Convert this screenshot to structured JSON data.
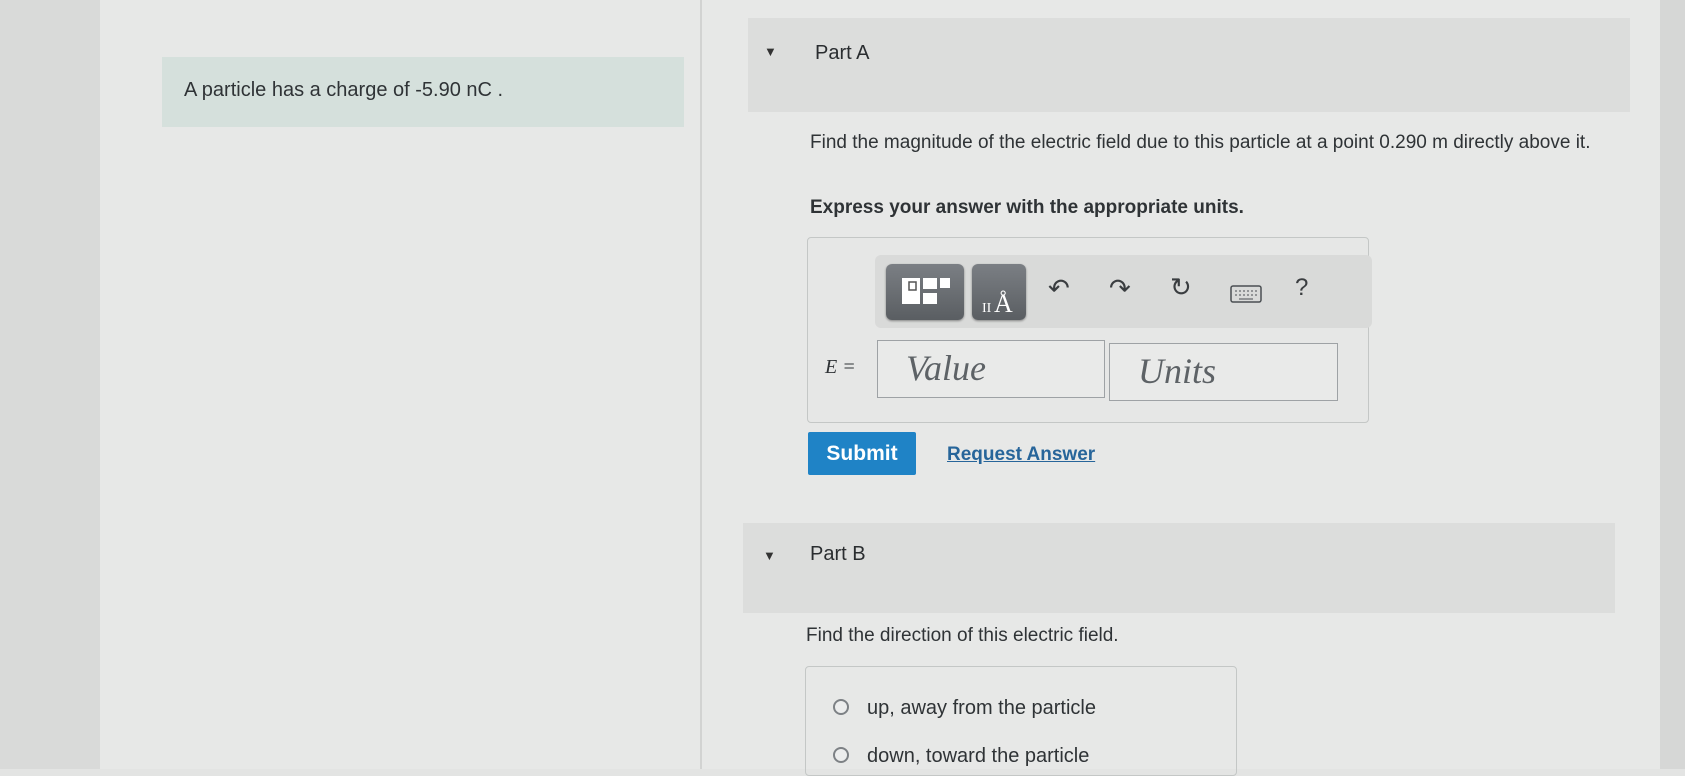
{
  "problem": {
    "statement": "A particle has a charge of -5.90  nC ."
  },
  "part_a": {
    "title": "Part A",
    "question": "Find the magnitude of the electric field due to this particle at a point 0.290  m directly above it.",
    "instruction": "Express your answer with the appropriate units.",
    "toolbar": {
      "icons": [
        "templates-icon",
        "units-icon",
        "undo-icon",
        "redo-icon",
        "reset-icon",
        "keyboard-icon",
        "help-icon"
      ],
      "help_label": "?"
    },
    "variable_label": "E =",
    "value_placeholder": "Value",
    "units_placeholder": "Units",
    "submit_label": "Submit",
    "request_answer_label": "Request Answer"
  },
  "part_b": {
    "title": "Part B",
    "question": "Find the direction of this electric field.",
    "options": [
      "up, away from the particle",
      "down, toward the particle"
    ]
  },
  "colors": {
    "accent": "#1f83c6",
    "link": "#27659a",
    "problem_bg": "#d5e0dc"
  }
}
